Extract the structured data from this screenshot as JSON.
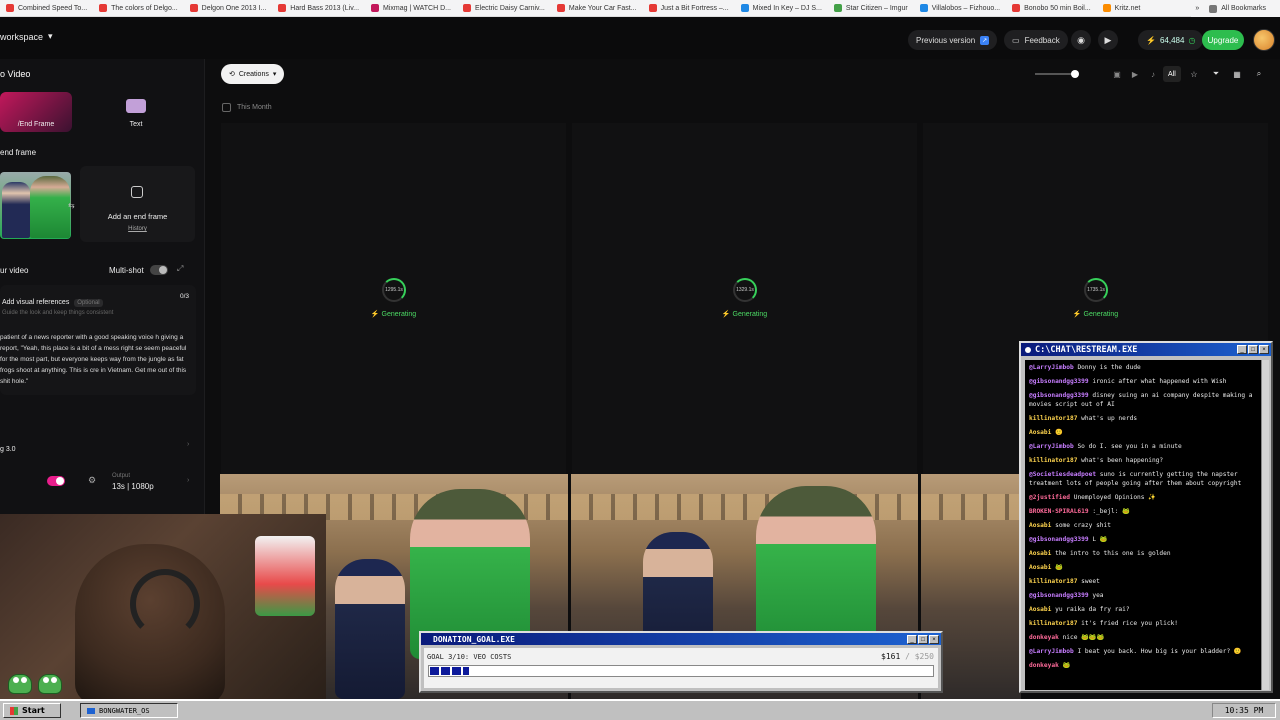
{
  "bookmarks": [
    {
      "label": "Combined Speed To...",
      "color": "#e53935"
    },
    {
      "label": "The colors of Delgo...",
      "color": "#e53935"
    },
    {
      "label": "Delgon One 2013 I...",
      "color": "#e53935"
    },
    {
      "label": "Hard Bass 2013 (Liv...",
      "color": "#e53935"
    },
    {
      "label": "Mixmag | WATCH D...",
      "color": "#c2185b"
    },
    {
      "label": "Electric Daisy Carniv...",
      "color": "#e53935"
    },
    {
      "label": "Make Your Car Fast...",
      "color": "#e53935"
    },
    {
      "label": "Just a Bit Fortress –...",
      "color": "#e53935"
    },
    {
      "label": "Mixed In Key – DJ S...",
      "color": "#1e88e5"
    },
    {
      "label": "Star Citizen – Imgur",
      "color": "#43a047"
    },
    {
      "label": "Villalobos – Fizhouo...",
      "color": "#1e88e5"
    },
    {
      "label": "Bonobo 50 min Boil...",
      "color": "#e53935"
    },
    {
      "label": "Kritz.net",
      "color": "#fb8c00"
    }
  ],
  "all_bookmarks": "All Bookmarks",
  "topbar": {
    "workspace": "workspace",
    "previous_version": "Previous version",
    "feedback": "Feedback",
    "credits": "64,484",
    "upgrade": "Upgrade"
  },
  "left": {
    "title": "o Video",
    "modes": [
      "/End Frame",
      "Text"
    ],
    "end_frame_heading": "end frame",
    "add_end_frame": "Add an end frame",
    "history": "History",
    "your_video": "ur video",
    "multi_shot": "Multi-shot",
    "visual_refs": "Add visual references",
    "optional": "Optional",
    "refs_count": "0/3",
    "refs_hint": "Guide the look and keep things consistent",
    "prompt": "patient of a news reporter with a good speaking voice h giving a report, \"Yeah, this place is a bit of a mess right se seem peaceful for the most part, but everyone keeps way from the jungle as fat frogs shoot at anything. This is cre in Vietnam. Get me out of this shit hole.\"",
    "model": "g 3.0",
    "output_label": "Output",
    "output_value": "13s | 1080p"
  },
  "main": {
    "creations": "Creations",
    "this_month": "This Month",
    "filter_all": "All",
    "cards": [
      {
        "time": "1295.1s",
        "status": "Generating"
      },
      {
        "time": "1329.1s",
        "status": "Generating"
      },
      {
        "time": "1735.1s",
        "status": "Generating"
      }
    ]
  },
  "chat": {
    "title": "C:\\CHAT\\RESTREAM.EXE",
    "messages": [
      {
        "user": "@LarryJimbob",
        "text": "Donny is the dude",
        "color": "#c77dff"
      },
      {
        "user": "@gibsonandgg3399",
        "text": "ironic after what happened with Wish",
        "color": "#c77dff"
      },
      {
        "user": "@gibsonandgg3399",
        "text": "disney suing an ai company despite making a movies script out of AI",
        "color": "#c77dff"
      },
      {
        "user": "killinator187",
        "text": "what's up nerds",
        "color": "#ffd54f"
      },
      {
        "user": "Aosabi",
        "text": "🙂",
        "color": "#ffd54f"
      },
      {
        "user": "@LarryJimbob",
        "text": "So do I. see you in a minute",
        "color": "#c77dff"
      },
      {
        "user": "killinator187",
        "text": "what's been happening?",
        "color": "#ffd54f"
      },
      {
        "user": "@Societiesdeadpoet",
        "text": "suno is currently getting the napster treatment lots of people going after them about copyright",
        "color": "#c77dff"
      },
      {
        "user": "@2justified",
        "text": "Unemployed Opinions ✨",
        "color": "#ff6b9a"
      },
      {
        "user": "BROKEN-SPIRAL619",
        "text": ":_bejl: 🐸",
        "color": "#ff6b9a"
      },
      {
        "user": "Aosabi",
        "text": "some crazy shit",
        "color": "#ffd54f"
      },
      {
        "user": "@gibsonandgg3399",
        "text": "L 🐸",
        "color": "#c77dff"
      },
      {
        "user": "Aosabi",
        "text": "the intro to this one is golden",
        "color": "#ffd54f"
      },
      {
        "user": "Aosabi",
        "text": "🐸",
        "color": "#ffd54f"
      },
      {
        "user": "killinator187",
        "text": "sweet",
        "color": "#ffd54f"
      },
      {
        "user": "@gibsonandgg3399",
        "text": "yea",
        "color": "#c77dff"
      },
      {
        "user": "Aosabi",
        "text": "yu raika da fry rai?",
        "color": "#ffd54f"
      },
      {
        "user": "killinator187",
        "text": "it's fried rice you plick!",
        "color": "#ffd54f"
      },
      {
        "user": "donkeyak",
        "text": "nice 🐸🐸🐸",
        "color": "#ff6b9a"
      },
      {
        "user": "@LarryJimbob",
        "text": "I beat you back. How big is your bladder? 🙂",
        "color": "#c77dff"
      },
      {
        "user": "donkeyak",
        "text": "🐸",
        "color": "#ff6b9a"
      }
    ]
  },
  "donation": {
    "title": "DONATION_GOAL.EXE",
    "goal": "GOAL 3/10: VEO COSTS",
    "amount": "$161",
    "max": "/ $250",
    "progress": 0.644
  },
  "taskbar": {
    "start": "Start",
    "task": "BONGWATER_OS",
    "clock": "10:35 PM"
  }
}
